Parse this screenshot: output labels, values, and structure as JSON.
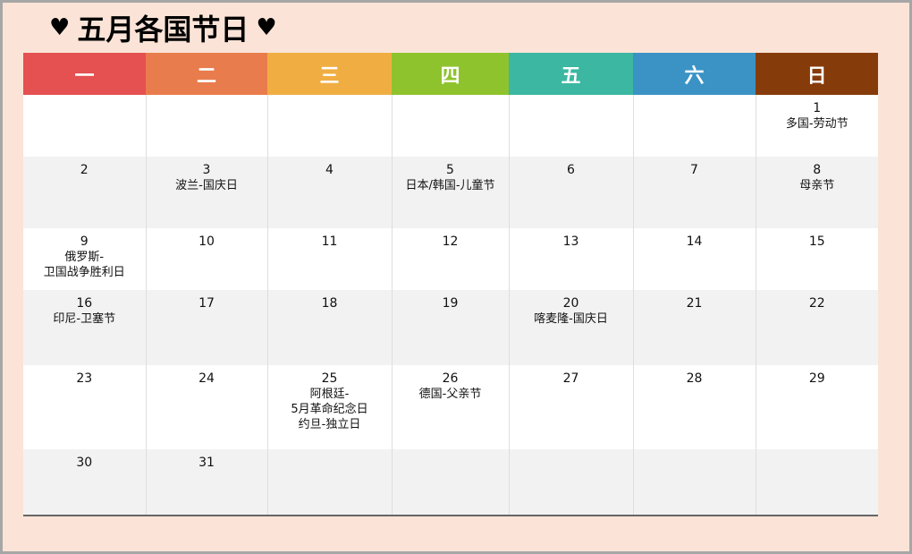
{
  "title": {
    "heart_left": "♥",
    "text": "五月各国节日",
    "heart_right": "♥"
  },
  "colors": {
    "frame_bg": "#fbe4d7",
    "frame_border": "#a6a6a6",
    "header": [
      "#e55050",
      "#e97c4c",
      "#f0ae42",
      "#8fc32d",
      "#3bb7a2",
      "#3a93c4",
      "#863b0a"
    ]
  },
  "weekdays": [
    "一",
    "二",
    "三",
    "四",
    "五",
    "六",
    "日"
  ],
  "weeks": [
    [
      {
        "day": "",
        "notes": []
      },
      {
        "day": "",
        "notes": []
      },
      {
        "day": "",
        "notes": []
      },
      {
        "day": "",
        "notes": []
      },
      {
        "day": "",
        "notes": []
      },
      {
        "day": "",
        "notes": []
      },
      {
        "day": "1",
        "notes": [
          "多国-劳动节"
        ]
      }
    ],
    [
      {
        "day": "2",
        "notes": []
      },
      {
        "day": "3",
        "notes": [
          "波兰-国庆日"
        ]
      },
      {
        "day": "4",
        "notes": []
      },
      {
        "day": "5",
        "notes": [
          "日本/韩国-儿童节"
        ]
      },
      {
        "day": "6",
        "notes": []
      },
      {
        "day": "7",
        "notes": []
      },
      {
        "day": "8",
        "notes": [
          "母亲节"
        ]
      }
    ],
    [
      {
        "day": "9",
        "notes": [
          "俄罗斯-",
          "卫国战争胜利日"
        ]
      },
      {
        "day": "10",
        "notes": []
      },
      {
        "day": "11",
        "notes": []
      },
      {
        "day": "12",
        "notes": []
      },
      {
        "day": "13",
        "notes": []
      },
      {
        "day": "14",
        "notes": []
      },
      {
        "day": "15",
        "notes": []
      }
    ],
    [
      {
        "day": "16",
        "notes": [
          "印尼-卫塞节"
        ]
      },
      {
        "day": "17",
        "notes": []
      },
      {
        "day": "18",
        "notes": []
      },
      {
        "day": "19",
        "notes": []
      },
      {
        "day": "20",
        "notes": [
          "喀麦隆-国庆日"
        ]
      },
      {
        "day": "21",
        "notes": []
      },
      {
        "day": "22",
        "notes": []
      }
    ],
    [
      {
        "day": "23",
        "notes": []
      },
      {
        "day": "24",
        "notes": []
      },
      {
        "day": "25",
        "notes": [
          "阿根廷-",
          "5月革命纪念日",
          "约旦-独立日"
        ]
      },
      {
        "day": "26",
        "notes": [
          "德国-父亲节"
        ]
      },
      {
        "day": "27",
        "notes": []
      },
      {
        "day": "28",
        "notes": []
      },
      {
        "day": "29",
        "notes": []
      }
    ],
    [
      {
        "day": "30",
        "notes": []
      },
      {
        "day": "31",
        "notes": []
      },
      {
        "day": "",
        "notes": []
      },
      {
        "day": "",
        "notes": []
      },
      {
        "day": "",
        "notes": []
      },
      {
        "day": "",
        "notes": []
      },
      {
        "day": "",
        "notes": []
      }
    ]
  ]
}
